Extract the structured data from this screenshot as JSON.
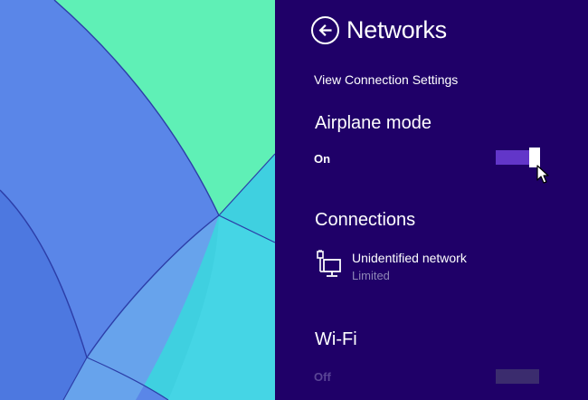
{
  "panel": {
    "title": "Networks",
    "view_settings_label": "View Connection Settings",
    "background_color": "#1f0068"
  },
  "airplane_mode": {
    "heading": "Airplane mode",
    "state_label": "On",
    "is_on": true,
    "toggle_color": "#6236c9"
  },
  "connections": {
    "heading": "Connections",
    "items": [
      {
        "name": "Unidentified network",
        "status": "Limited",
        "icon": "wired-network-icon"
      }
    ]
  },
  "wifi": {
    "heading": "Wi-Fi",
    "state_label": "Off",
    "is_on": false,
    "enabled": false
  },
  "icons": {
    "back": "back-arrow-circle-icon",
    "cursor": "mouse-pointer-icon"
  }
}
